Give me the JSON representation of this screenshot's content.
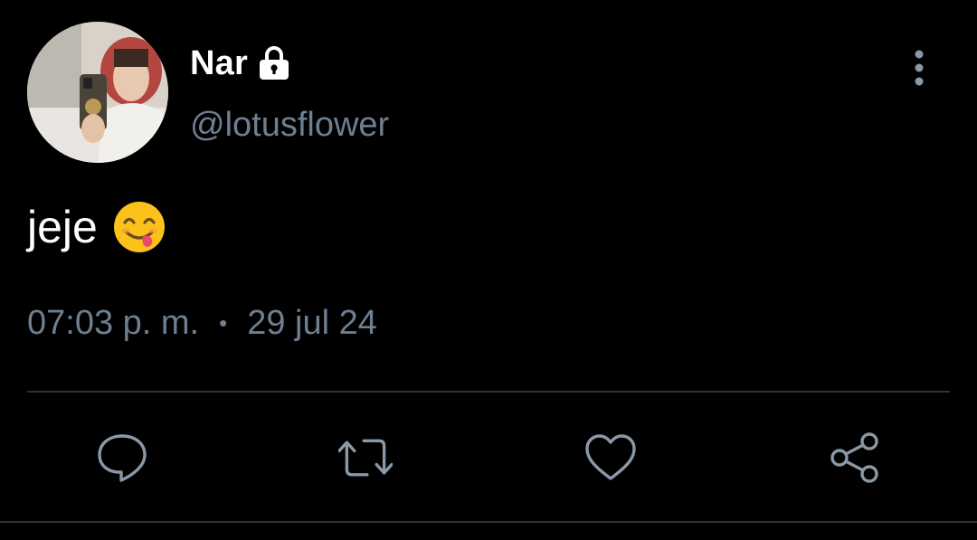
{
  "user": {
    "display_name": "Nar",
    "handle": "@lotusflower",
    "protected": true
  },
  "tweet": {
    "text": "jeje",
    "emoji": "yum-face-emoji",
    "time": "07:03 p. m.",
    "separator": "•",
    "date": "29 jul 24"
  },
  "icons": {
    "lock": "lock-icon",
    "more": "vertical-ellipsis-icon",
    "reply": "speech-bubble-icon",
    "retweet": "retweet-icon",
    "like": "heart-icon",
    "share": "share-nodes-icon"
  },
  "colors": {
    "background": "#000000",
    "primary_text": "#ffffff",
    "secondary_text": "#6e7f91",
    "divider": "#2f3336"
  }
}
